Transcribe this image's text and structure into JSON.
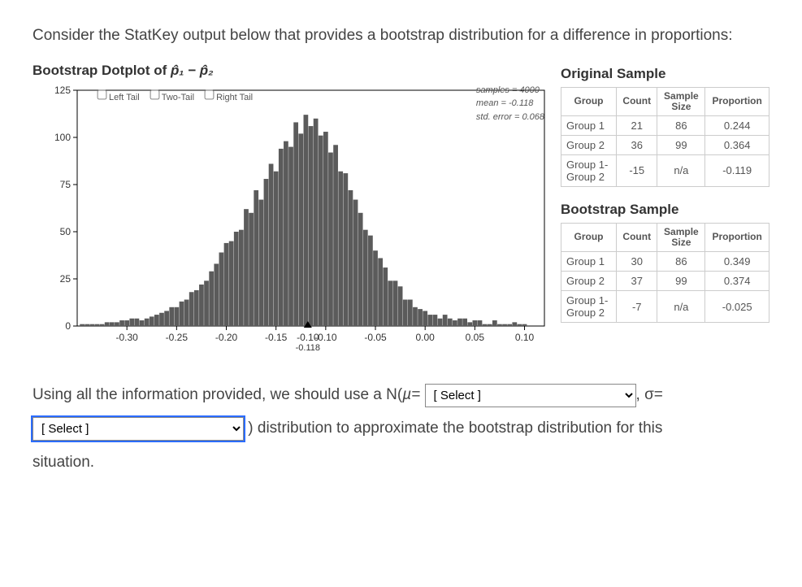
{
  "question": {
    "intro": "Consider the StatKey output below that provides a bootstrap distribution for a difference in proportions:",
    "line_prefix": "Using all the information provided, we should use a N(",
    "mu_label": "µ=",
    "after_mu": ", σ=",
    "line2_suffix": ") distribution to approximate the bootstrap distribution for this",
    "line3": "situation.",
    "select_placeholder": "[ Select ]"
  },
  "chart": {
    "title_prefix": "Bootstrap Dotplot of ",
    "title_symbol": "p̂₁ − p̂₂",
    "tails": {
      "left": "Left Tail",
      "two": "Two-Tail",
      "right": "Right Tail"
    },
    "stats": {
      "samples_label": "samples = ",
      "samples_value": "4000",
      "mean_label": "mean = ",
      "mean_value": "-0.118",
      "stderr_label": "std. error = ",
      "stderr_value": "0.068"
    },
    "xticks": [
      "-0.30",
      "-0.25",
      "-0.20",
      "-0.15",
      "-0.10",
      "-0.05",
      "0.00",
      "0.05",
      "0.10"
    ],
    "yticks": [
      "0",
      "25",
      "50",
      "75",
      "100",
      "125"
    ],
    "center_marker": "-0.118",
    "center_marker_top": "-0.10"
  },
  "original": {
    "heading": "Original Sample",
    "headers": [
      "Group",
      "Count",
      "Sample\nSize",
      "Proportion"
    ],
    "rows": [
      [
        "Group 1",
        "21",
        "86",
        "0.244"
      ],
      [
        "Group 2",
        "36",
        "99",
        "0.364"
      ],
      [
        "Group 1-\nGroup 2",
        "-15",
        "n/a",
        "-0.119"
      ]
    ]
  },
  "bootstrap": {
    "heading": "Bootstrap Sample",
    "headers": [
      "Group",
      "Count",
      "Sample\nSize",
      "Proportion"
    ],
    "rows": [
      [
        "Group 1",
        "30",
        "86",
        "0.349"
      ],
      [
        "Group 2",
        "37",
        "99",
        "0.374"
      ],
      [
        "Group 1-\nGroup 2",
        "-7",
        "n/a",
        "-0.025"
      ]
    ]
  },
  "chart_data": {
    "type": "bar",
    "title": "Bootstrap Dotplot of p̂1 − p̂2",
    "xlabel": "",
    "ylabel": "",
    "xlim": [
      -0.35,
      0.12
    ],
    "ylim": [
      0,
      125
    ],
    "samples": 4000,
    "mean": -0.118,
    "std_error": 0.068,
    "bins": [
      {
        "x": -0.345,
        "y": 1
      },
      {
        "x": -0.34,
        "y": 1
      },
      {
        "x": -0.335,
        "y": 1
      },
      {
        "x": -0.33,
        "y": 1
      },
      {
        "x": -0.325,
        "y": 1
      },
      {
        "x": -0.32,
        "y": 2
      },
      {
        "x": -0.315,
        "y": 2
      },
      {
        "x": -0.31,
        "y": 2
      },
      {
        "x": -0.305,
        "y": 3
      },
      {
        "x": -0.3,
        "y": 3
      },
      {
        "x": -0.295,
        "y": 4
      },
      {
        "x": -0.29,
        "y": 4
      },
      {
        "x": -0.285,
        "y": 3
      },
      {
        "x": -0.28,
        "y": 4
      },
      {
        "x": -0.275,
        "y": 5
      },
      {
        "x": -0.27,
        "y": 6
      },
      {
        "x": -0.265,
        "y": 7
      },
      {
        "x": -0.26,
        "y": 8
      },
      {
        "x": -0.255,
        "y": 10
      },
      {
        "x": -0.25,
        "y": 10
      },
      {
        "x": -0.245,
        "y": 13
      },
      {
        "x": -0.24,
        "y": 14
      },
      {
        "x": -0.235,
        "y": 18
      },
      {
        "x": -0.23,
        "y": 19
      },
      {
        "x": -0.225,
        "y": 22
      },
      {
        "x": -0.22,
        "y": 24
      },
      {
        "x": -0.215,
        "y": 29
      },
      {
        "x": -0.21,
        "y": 33
      },
      {
        "x": -0.205,
        "y": 39
      },
      {
        "x": -0.2,
        "y": 44
      },
      {
        "x": -0.195,
        "y": 45
      },
      {
        "x": -0.19,
        "y": 50
      },
      {
        "x": -0.185,
        "y": 51
      },
      {
        "x": -0.18,
        "y": 62
      },
      {
        "x": -0.175,
        "y": 60
      },
      {
        "x": -0.17,
        "y": 72
      },
      {
        "x": -0.165,
        "y": 67
      },
      {
        "x": -0.16,
        "y": 78
      },
      {
        "x": -0.155,
        "y": 86
      },
      {
        "x": -0.15,
        "y": 82
      },
      {
        "x": -0.145,
        "y": 94
      },
      {
        "x": -0.14,
        "y": 98
      },
      {
        "x": -0.135,
        "y": 95
      },
      {
        "x": -0.13,
        "y": 108
      },
      {
        "x": -0.125,
        "y": 102
      },
      {
        "x": -0.12,
        "y": 112
      },
      {
        "x": -0.115,
        "y": 106
      },
      {
        "x": -0.11,
        "y": 110
      },
      {
        "x": -0.105,
        "y": 101
      },
      {
        "x": -0.1,
        "y": 103
      },
      {
        "x": -0.095,
        "y": 92
      },
      {
        "x": -0.09,
        "y": 96
      },
      {
        "x": -0.085,
        "y": 82
      },
      {
        "x": -0.08,
        "y": 81
      },
      {
        "x": -0.075,
        "y": 72
      },
      {
        "x": -0.07,
        "y": 67
      },
      {
        "x": -0.065,
        "y": 60
      },
      {
        "x": -0.06,
        "y": 51
      },
      {
        "x": -0.055,
        "y": 48
      },
      {
        "x": -0.05,
        "y": 40
      },
      {
        "x": -0.045,
        "y": 36
      },
      {
        "x": -0.04,
        "y": 31
      },
      {
        "x": -0.035,
        "y": 24
      },
      {
        "x": -0.03,
        "y": 24
      },
      {
        "x": -0.025,
        "y": 21
      },
      {
        "x": -0.02,
        "y": 14
      },
      {
        "x": -0.015,
        "y": 14
      },
      {
        "x": -0.01,
        "y": 10
      },
      {
        "x": -0.005,
        "y": 9
      },
      {
        "x": 0.0,
        "y": 8
      },
      {
        "x": 0.005,
        "y": 6
      },
      {
        "x": 0.01,
        "y": 6
      },
      {
        "x": 0.015,
        "y": 4
      },
      {
        "x": 0.02,
        "y": 6
      },
      {
        "x": 0.025,
        "y": 4
      },
      {
        "x": 0.03,
        "y": 3
      },
      {
        "x": 0.035,
        "y": 4
      },
      {
        "x": 0.04,
        "y": 4
      },
      {
        "x": 0.045,
        "y": 2
      },
      {
        "x": 0.05,
        "y": 3
      },
      {
        "x": 0.055,
        "y": 3
      },
      {
        "x": 0.06,
        "y": 1
      },
      {
        "x": 0.065,
        "y": 1
      },
      {
        "x": 0.07,
        "y": 3
      },
      {
        "x": 0.075,
        "y": 1
      },
      {
        "x": 0.08,
        "y": 1
      },
      {
        "x": 0.085,
        "y": 1
      },
      {
        "x": 0.09,
        "y": 2
      },
      {
        "x": 0.095,
        "y": 1
      },
      {
        "x": 0.1,
        "y": 1
      }
    ]
  }
}
